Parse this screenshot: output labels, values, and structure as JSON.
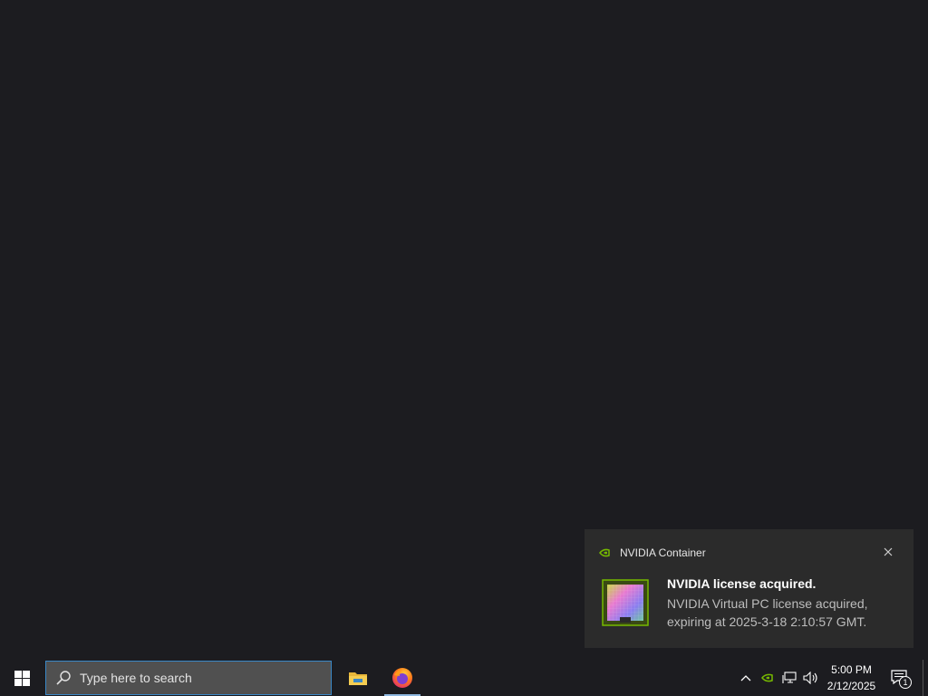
{
  "notification": {
    "app_name": "NVIDIA Container",
    "title": "NVIDIA license acquired.",
    "body_line1": "NVIDIA Virtual PC license acquired,",
    "body_line2": "expiring at 2025-3-18 2:10:57 GMT.",
    "app_icon": "nvidia-logo-icon",
    "image_icon": "gpu-chip-icon"
  },
  "taskbar": {
    "search_placeholder": "Type here to search",
    "pinned_apps": [
      "file-explorer-icon",
      "firefox-icon"
    ],
    "clock_time": "5:00 PM",
    "clock_date": "2/12/2025",
    "notification_count": "1"
  },
  "colors": {
    "desktop_background": "#1c1c20",
    "toast_background": "#2b2b2b",
    "search_box_border": "#3a87c6",
    "nvidia_green": "#76b900"
  }
}
